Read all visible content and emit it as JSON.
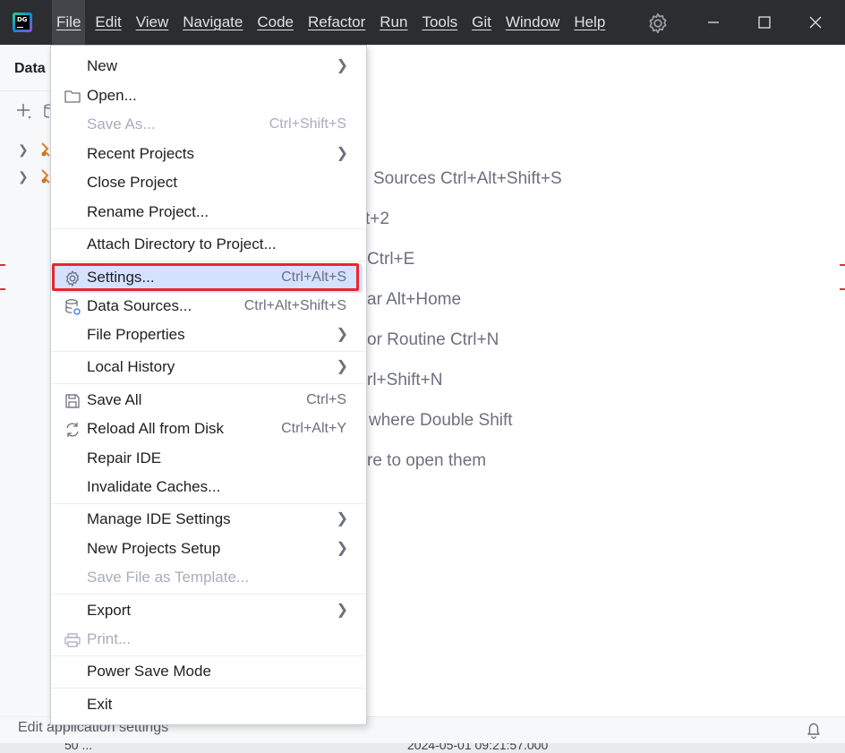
{
  "menubar": [
    "File",
    "Edit",
    "View",
    "Navigate",
    "Code",
    "Refactor",
    "Run",
    "Tools",
    "Git",
    "Window",
    "Help"
  ],
  "app_logo_text": "DG",
  "panel": {
    "title": "Data"
  },
  "hints": [
    "Sources Ctrl+Alt+Shift+S",
    "t+2",
    "Ctrl+E",
    "ar Alt+Home",
    "or Routine Ctrl+N",
    "rl+Shift+N",
    "where Double Shift",
    "re to open them"
  ],
  "file_menu": {
    "items": [
      {
        "label": "New",
        "shortcut": "",
        "submenu": true,
        "disabled": false,
        "icon": ""
      },
      {
        "label": "Open...",
        "shortcut": "",
        "submenu": false,
        "disabled": false,
        "icon": "folder-icon"
      },
      {
        "label": "Save As...",
        "shortcut": "Ctrl+Shift+S",
        "submenu": false,
        "disabled": true,
        "icon": ""
      },
      {
        "label": "Recent Projects",
        "shortcut": "",
        "submenu": true,
        "disabled": false,
        "icon": ""
      },
      {
        "label": "Close Project",
        "shortcut": "",
        "submenu": false,
        "disabled": false,
        "icon": ""
      },
      {
        "label": "Rename Project...",
        "shortcut": "",
        "submenu": false,
        "disabled": false,
        "icon": ""
      },
      {
        "label": "Attach Directory to Project...",
        "shortcut": "",
        "submenu": false,
        "disabled": false,
        "icon": ""
      },
      {
        "label": "Settings...",
        "shortcut": "Ctrl+Alt+S",
        "submenu": false,
        "disabled": false,
        "icon": "gear-icon",
        "selected": true
      },
      {
        "label": "Data Sources...",
        "shortcut": "Ctrl+Alt+Shift+S",
        "submenu": false,
        "disabled": false,
        "icon": "database-icon"
      },
      {
        "label": "File Properties",
        "shortcut": "",
        "submenu": true,
        "disabled": false,
        "icon": ""
      },
      {
        "label": "Local History",
        "shortcut": "",
        "submenu": true,
        "disabled": false,
        "icon": ""
      },
      {
        "label": "Save All",
        "shortcut": "Ctrl+S",
        "submenu": false,
        "disabled": false,
        "icon": "save-icon"
      },
      {
        "label": "Reload All from Disk",
        "shortcut": "Ctrl+Alt+Y",
        "submenu": false,
        "disabled": false,
        "icon": "reload-icon"
      },
      {
        "label": "Repair IDE",
        "shortcut": "",
        "submenu": false,
        "disabled": false,
        "icon": ""
      },
      {
        "label": "Invalidate Caches...",
        "shortcut": "",
        "submenu": false,
        "disabled": false,
        "icon": ""
      },
      {
        "label": "Manage IDE Settings",
        "shortcut": "",
        "submenu": true,
        "disabled": false,
        "icon": ""
      },
      {
        "label": "New Projects Setup",
        "shortcut": "",
        "submenu": true,
        "disabled": false,
        "icon": ""
      },
      {
        "label": "Save File as Template...",
        "shortcut": "",
        "submenu": false,
        "disabled": true,
        "icon": ""
      },
      {
        "label": "Export",
        "shortcut": "",
        "submenu": true,
        "disabled": false,
        "icon": ""
      },
      {
        "label": "Print...",
        "shortcut": "",
        "submenu": false,
        "disabled": true,
        "icon": "printer-icon"
      },
      {
        "label": "Power Save Mode",
        "shortcut": "",
        "submenu": false,
        "disabled": false,
        "icon": ""
      },
      {
        "label": "Exit",
        "shortcut": "",
        "submenu": false,
        "disabled": false,
        "icon": ""
      }
    ]
  },
  "statusbar": {
    "text": "Edit application settings"
  },
  "bottom_strip": [
    "50  ...",
    "2024-05-01 09:21:57.000"
  ]
}
